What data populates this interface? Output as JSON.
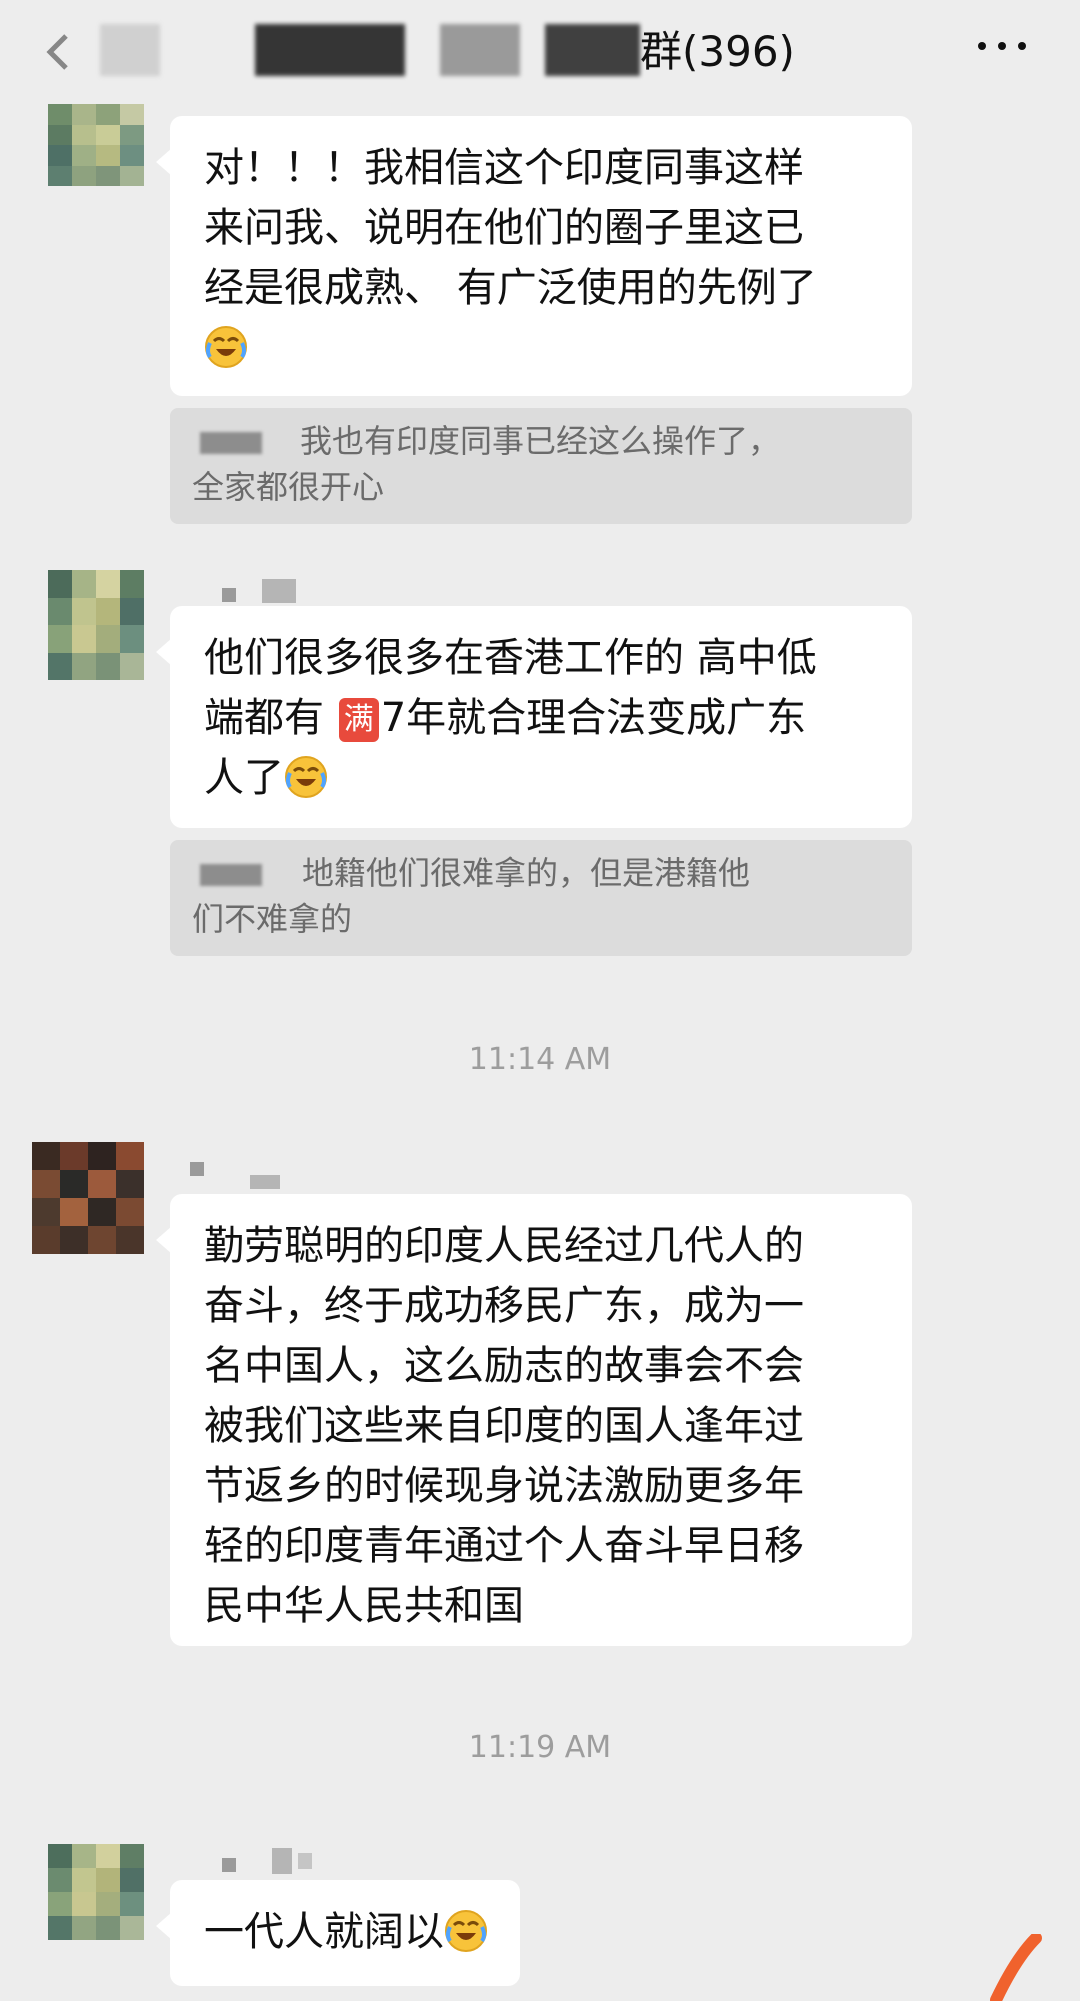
{
  "header": {
    "title_suffix": "群(396)",
    "more_icon": "more-icon",
    "back_icon": "back-icon"
  },
  "colors": {
    "background": "#ededed",
    "bubble": "#ffffff",
    "quote": "#dcdcdc",
    "badge": "#e84a3c"
  },
  "messages": [
    {
      "lines": [
        "对！！！我相信这个印度同事这样",
        "来问我、说明在他们的圈子里这已",
        "经是很成熟、 有广泛使用的先例了"
      ],
      "emoji": "crying-laughing-emoji",
      "quote": [
        "我也有印度同事已经这么操作了，",
        "全家都很开心"
      ]
    },
    {
      "line1": "他们很多很多在香港工作的 高中低",
      "line2_a": "端都有 ",
      "badge": "满",
      "line2_b": "7年就合理合法变成广东",
      "line3": "人了",
      "emoji": "crying-laughing-emoji",
      "quote": [
        "地籍他们很难拿的，但是港籍他",
        "们不难拿的"
      ]
    },
    {
      "lines": [
        "勤劳聪明的印度人民经过几代人的",
        "奋斗，终于成功移民广东，成为一",
        "名中国人，这么励志的故事会不会",
        "被我们这些来自印度的国人逢年过",
        "节返乡的时候现身说法激励更多年",
        "轻的印度青年通过个人奋斗早日移",
        "民中华人民共和国"
      ]
    },
    {
      "text": "一代人就阔以",
      "emoji": "crying-laughing-emoji"
    }
  ],
  "timestamps": [
    "11:14 AM",
    "11:19 AM"
  ]
}
